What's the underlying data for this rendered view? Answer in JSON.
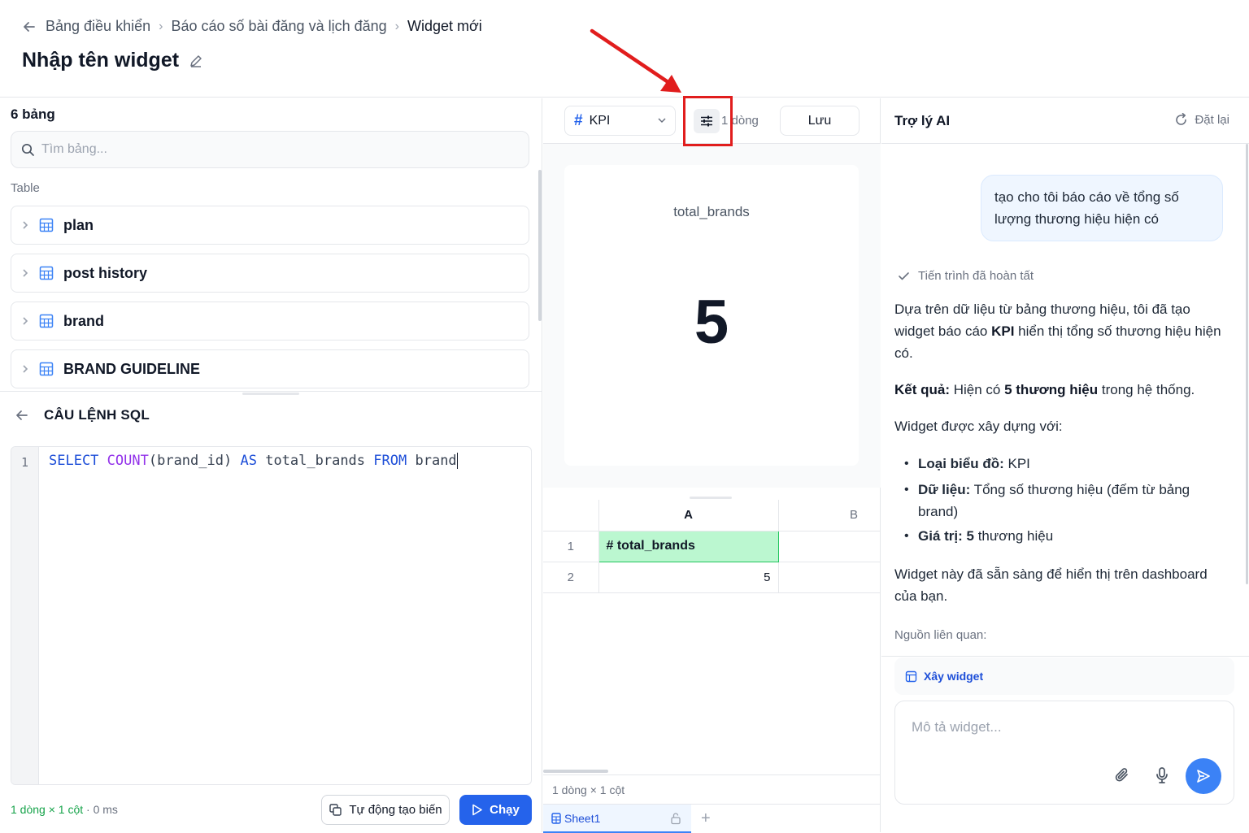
{
  "header": {
    "breadcrumbs": [
      "Bảng điều khiển",
      "Báo cáo số bài đăng và lịch đăng",
      "Widget mới"
    ],
    "title": "Nhập tên widget"
  },
  "left": {
    "tables_count": "6 bảng",
    "search_placeholder": "Tìm bảng...",
    "section_label": "Table",
    "tables": [
      "plan",
      "post history",
      "brand",
      "BRAND GUIDELINE"
    ],
    "sql_label": "CÂU LỆNH SQL",
    "sql": {
      "line_number": "1",
      "tokens": [
        "SELECT",
        "COUNT",
        "(brand_id)",
        "AS",
        "total_brands",
        "FROM",
        "brand"
      ]
    },
    "status": {
      "dims": "1 dòng × 1 cột",
      "time": "· 0 ms"
    },
    "auto_button": "Tự động tạo biến",
    "run_button": "Chạy"
  },
  "middle": {
    "chart_type": "KPI",
    "rows_label": "1 dòng",
    "save_button": "Lưu",
    "kpi": {
      "label": "total_brands",
      "value": "5"
    },
    "grid": {
      "columns": [
        "A",
        "B"
      ],
      "rows": [
        {
          "num": "1",
          "a": "# total_brands",
          "b": ""
        },
        {
          "num": "2",
          "a": "5",
          "b": ""
        }
      ]
    },
    "status": "1 dòng × 1 cột",
    "sheet_tab": "Sheet1"
  },
  "right": {
    "title": "Trợ lý AI",
    "reset": "Đặt lại",
    "user_message": "tạo cho tôi báo cáo về tổng số lượng thương hiệu hiện có",
    "process_done": "Tiến trình đã hoàn tất",
    "reply": {
      "p1_a": "Dựa trên dữ liệu từ bảng thương hiệu, tôi đã tạo widget báo cáo ",
      "p1_b": "KPI",
      "p1_c": " hiển thị tổng số thương hiệu hiện có.",
      "p2_a": "Kết quả:",
      "p2_b": " Hiện có ",
      "p2_c": "5 thương hiệu",
      "p2_d": " trong hệ thống.",
      "p3": "Widget được xây dựng với:",
      "bullets": [
        {
          "key": "Loại biểu đồ:",
          "val": " KPI"
        },
        {
          "key": "Dữ liệu:",
          "val": " Tổng số thương hiệu (đếm từ bảng brand)"
        },
        {
          "key": "Giá trị: 5",
          "val": " thương hiệu"
        }
      ],
      "p4": "Widget này đã sẵn sàng để hiển thị trên dashboard của bạn."
    },
    "sources": "Nguồn liên quan:",
    "build_chip": "Xây widget",
    "input_placeholder": "Mô tả widget..."
  },
  "colors": {
    "accent": "#2563eb",
    "highlight": "#e11d1d",
    "cell_green": "#bbf7d0"
  }
}
